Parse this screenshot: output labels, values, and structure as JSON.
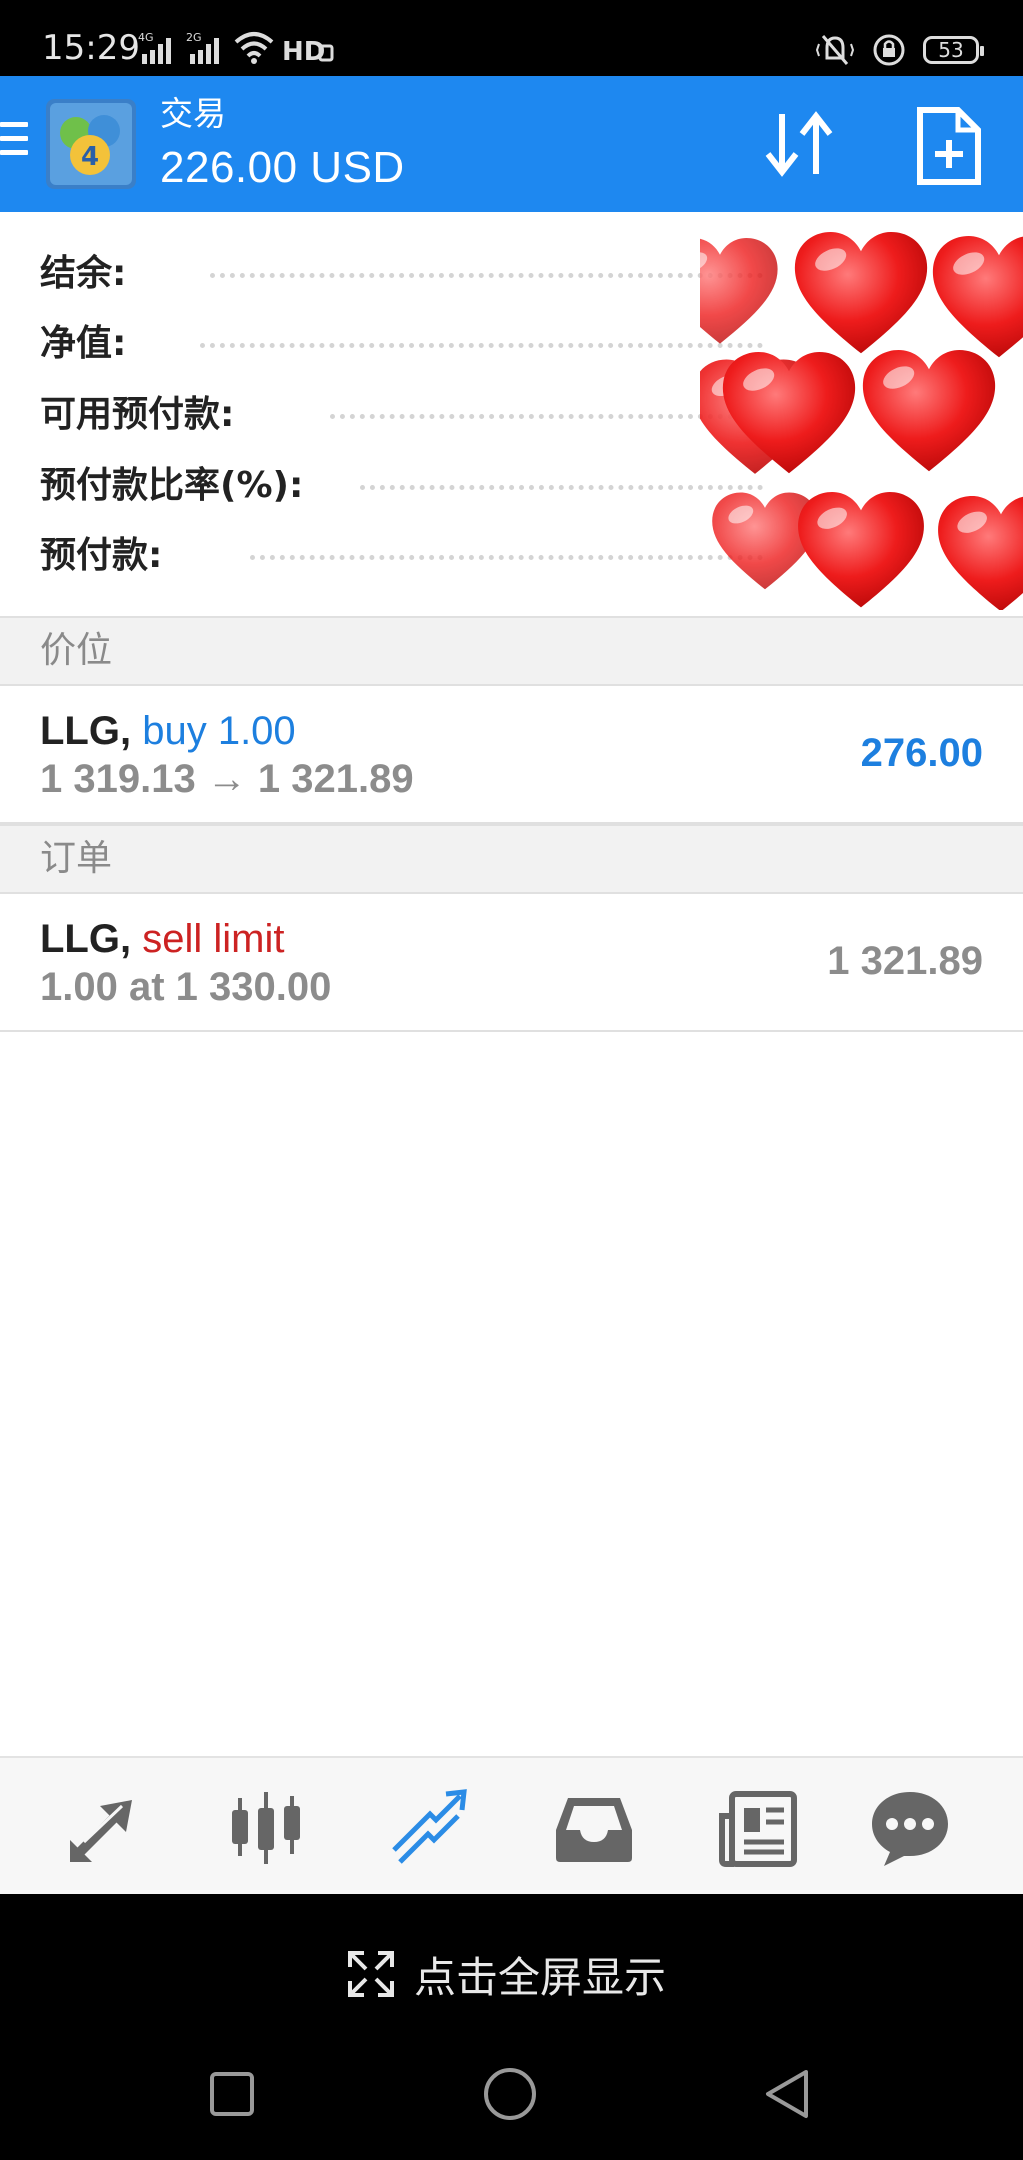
{
  "status_bar": {
    "time": "15:29",
    "network_1": "4G",
    "network_2": "2G",
    "hd_label": "HD",
    "battery_level": "53",
    "icons": [
      "signal-4g-icon",
      "signal-2g-icon",
      "wifi-icon",
      "hd-icon",
      "vibrate-icon",
      "lock-icon",
      "battery-icon"
    ]
  },
  "header": {
    "title": "交易",
    "balance": "226.00 USD",
    "icons": [
      "menu-icon",
      "app-logo",
      "sort-icon",
      "new-order-icon"
    ],
    "accent_color": "#1e88f0"
  },
  "summary": {
    "rows": [
      {
        "label": "结余:"
      },
      {
        "label": "净值:"
      },
      {
        "label": "可用预付款:"
      },
      {
        "label": "预付款比率(%):"
      },
      {
        "label": "预付款:"
      }
    ],
    "overlay": "hearts-sticker"
  },
  "positions": {
    "header": "价位",
    "items": [
      {
        "symbol": "LLG,",
        "action": "buy 1.00",
        "prices": "1 319.13 → 1 321.89",
        "value": "276.00"
      }
    ]
  },
  "orders": {
    "header": "订单",
    "items": [
      {
        "symbol": "LLG,",
        "action": "sell limit",
        "details": "1.00 at 1 330.00",
        "value": "1 321.89"
      }
    ]
  },
  "bottom_nav": {
    "items": [
      "quotes-icon",
      "chart-icon",
      "trade-icon",
      "history-icon",
      "news-icon",
      "chat-icon"
    ],
    "active": "trade-icon",
    "active_color": "#2b8ce6"
  },
  "fullscreen": {
    "text": "点击全屏显示"
  },
  "system_nav": [
    "recent-apps-icon",
    "home-icon",
    "back-icon"
  ]
}
